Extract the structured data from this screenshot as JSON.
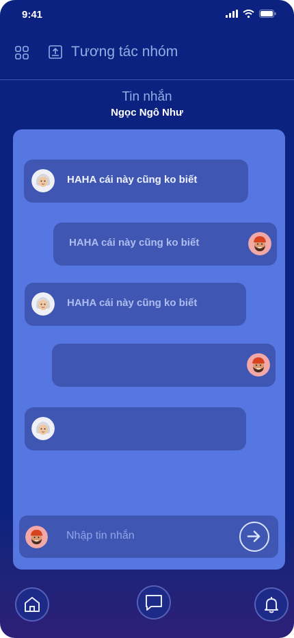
{
  "status": {
    "time": "9:41"
  },
  "appbar": {
    "title": "Tương tác nhóm"
  },
  "header": {
    "title": "Tin nhắn",
    "name": "Ngọc Ngô Như"
  },
  "messages": [
    {
      "side": "left",
      "text": "HAHA cái này cũng ko biết",
      "avatar": "girl-avatar"
    },
    {
      "side": "right",
      "text": "HAHA cái này cũng ko biết",
      "avatar": "boy-avatar"
    },
    {
      "side": "left",
      "text": "HAHA cái này cũng ko biết",
      "avatar": "girl-avatar"
    },
    {
      "side": "right",
      "text": "",
      "avatar": "boy-avatar"
    },
    {
      "side": "left",
      "text": "",
      "avatar": "girl-avatar"
    }
  ],
  "input": {
    "placeholder": "Nhập tin nhắn"
  },
  "nav": {
    "items": [
      "home-icon",
      "chat-icon",
      "bell-icon"
    ]
  },
  "colors": {
    "background": "#0b2280",
    "panel": "#5677e2",
    "bubble": "#3f56b3",
    "accent_text": "#8fb0e6"
  }
}
